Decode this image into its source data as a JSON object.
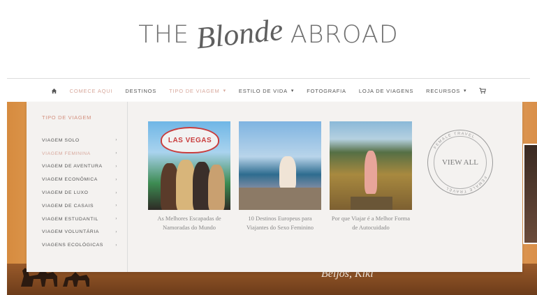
{
  "logo": {
    "left": "THE",
    "script": "Blonde",
    "right": "ABROAD"
  },
  "nav": {
    "items": [
      {
        "label": "COMECE AQUI",
        "accent": true,
        "caret": false
      },
      {
        "label": "DESTINOS",
        "accent": false,
        "caret": false
      },
      {
        "label": "TIPO DE VIAGEM",
        "accent": true,
        "caret": true
      },
      {
        "label": "ESTILO DE VIDA",
        "accent": false,
        "caret": true
      },
      {
        "label": "FOTOGRAFIA",
        "accent": false,
        "caret": false
      },
      {
        "label": "LOJA DE VIAGENS",
        "accent": false,
        "caret": false
      },
      {
        "label": "RECURSOS",
        "accent": false,
        "caret": true
      }
    ],
    "icons": {
      "home": "home-icon",
      "cart": "cart-icon"
    }
  },
  "dropdown": {
    "title": "TIPO DE VIAGEM",
    "items": [
      {
        "label": "VIAGEM SOLO",
        "active": false
      },
      {
        "label": "VIAGEM FEMININA",
        "active": true
      },
      {
        "label": "VIAGEM DE AVENTURA",
        "active": false
      },
      {
        "label": "VIAGEM ECONÔMICA",
        "active": false
      },
      {
        "label": "VIAGEM DE LUXO",
        "active": false
      },
      {
        "label": "VIAGEM DE CASAIS",
        "active": false
      },
      {
        "label": "VIAGEM ESTUDANTIL",
        "active": false
      },
      {
        "label": "VIAGEM VOLUNTÁRIA",
        "active": false
      },
      {
        "label": "VIAGENS ECOLÓGICAS",
        "active": false
      }
    ],
    "cards": [
      {
        "caption": "As Melhores Escapadas de Namoradas do Mundo",
        "sign": "LAS VEGAS"
      },
      {
        "caption": "10 Destinos Europeus para Viajantes do Sexo Feminino"
      },
      {
        "caption": "Por que Viajar é a Melhor Forma de Autocuidado"
      }
    ],
    "view_all": {
      "label": "VIEW ALL",
      "ring_text": "FEMALE TRAVEL"
    }
  },
  "hero": {
    "script_text": "Beijos, Kiki"
  },
  "colors": {
    "accent": "#d7a79b",
    "text": "#555555",
    "panel_bg": "#f4f2f0"
  }
}
